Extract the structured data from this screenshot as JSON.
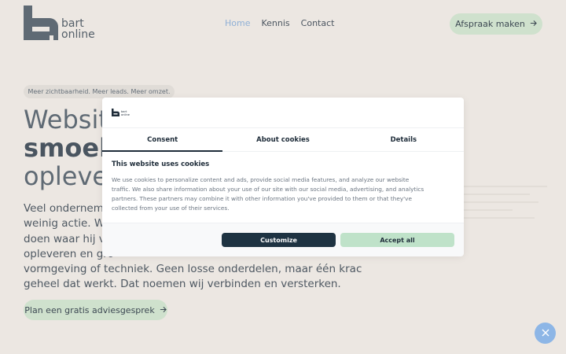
{
  "header": {
    "logo_line1": "bart",
    "logo_line2": "online",
    "nav": [
      "Home",
      "Kennis",
      "Contact"
    ],
    "cta": "Afspraak maken"
  },
  "hero": {
    "tagline": "Meer zichtbaarheid. Meer leads. Meer omzet.",
    "title_line1": "Websit",
    "title_line2": "smoele",
    "title_line3": "opleve",
    "body_lines": [
      "Veel onderneme",
      "weinig actie. Wij",
      "doen waar hij vo",
      "opleveren en gro",
      "vormgeving of techniek. Geen losse onderdelen, maar één krachtig",
      "geheel dat werkt. Dat noemen wij verbinden en versterken."
    ],
    "cta": "Plan een gratis adviesgesprek"
  },
  "cookie": {
    "logo_line1": "bart",
    "logo_line2": "online",
    "tabs": [
      "Consent",
      "About cookies",
      "Details"
    ],
    "title": "This website uses cookies",
    "text_lines": [
      "We use cookies to personalize content and ads, provide social media features, and analyze our website",
      "traffic. We also share information about your use of our site with our social media, advertising, and analytics",
      "partners. These partners may combine it with other information you've provided to them or that they've",
      "collected from your use of their services."
    ],
    "customize": "Customize",
    "accept": "Accept all"
  },
  "icons": [
    "logo-icon",
    "arrow-right-icon",
    "chat-icon"
  ],
  "colors": {
    "background": "#ece7e2",
    "accent_green": "#cfe1cd",
    "nav_active": "#8fb0d6",
    "dark_button": "#1e3342",
    "chat_blue": "#8db6e6"
  }
}
